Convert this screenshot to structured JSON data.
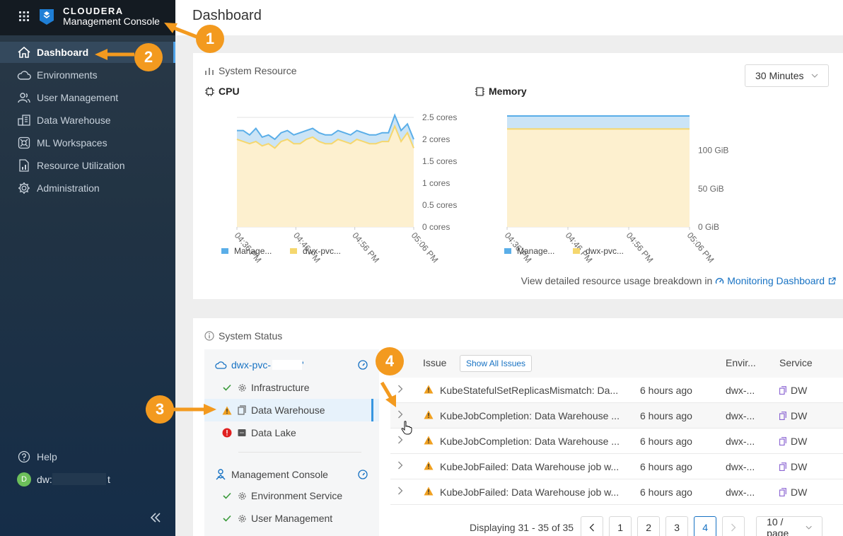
{
  "sidebar": {
    "brand_name": "CLOUDERA",
    "brand_sub": "Management Console",
    "items": [
      {
        "label": "Dashboard",
        "icon": "home-icon",
        "active": true
      },
      {
        "label": "Environments",
        "icon": "cloud-icon"
      },
      {
        "label": "User Management",
        "icon": "users-icon"
      },
      {
        "label": "Data Warehouse",
        "icon": "warehouse-icon"
      },
      {
        "label": "ML Workspaces",
        "icon": "ml-icon"
      },
      {
        "label": "Resource Utilization",
        "icon": "resource-icon"
      },
      {
        "label": "Administration",
        "icon": "gear-icon"
      }
    ],
    "help": "Help",
    "avatar_initial": "D",
    "user_prefix": "dw:",
    "user_suffix": "t"
  },
  "header": {
    "title": "Dashboard"
  },
  "resource": {
    "title": "System Resource",
    "range": "30 Minutes",
    "breakdown_text": "View detailed resource usage breakdown in",
    "breakdown_link": "Monitoring Dashboard"
  },
  "chart_data": [
    {
      "type": "area",
      "title": "CPU",
      "x": [
        "04:36 PM",
        "04:46 PM",
        "04:56 PM",
        "05:06 PM"
      ],
      "yticks": [
        "2.5 cores",
        "2 cores",
        "1.5 cores",
        "1 cores",
        "0.5 cores",
        "0 cores"
      ],
      "ylim": [
        0,
        2.5
      ],
      "series": [
        {
          "name": "Manage...",
          "color": "#5aaee8",
          "values": [
            2.2,
            2.2,
            2.1,
            2.25,
            2.05,
            2.1,
            2.0,
            2.15,
            2.2,
            2.1,
            2.15,
            2.2,
            2.25,
            2.15,
            2.1,
            2.1,
            2.2,
            2.15,
            2.1,
            2.2,
            2.15,
            2.1,
            2.1,
            2.15,
            2.15,
            2.55,
            2.2,
            2.35,
            2.0
          ]
        },
        {
          "name": "dwx-pvc...",
          "color": "#f5d76e",
          "values": [
            2.0,
            1.95,
            1.9,
            1.95,
            1.85,
            1.9,
            1.8,
            1.95,
            2.0,
            1.9,
            1.9,
            2.0,
            2.05,
            1.95,
            1.9,
            1.9,
            2.0,
            1.95,
            1.9,
            2.0,
            1.95,
            1.9,
            1.9,
            1.95,
            1.95,
            2.3,
            1.95,
            2.15,
            1.8
          ]
        }
      ]
    },
    {
      "type": "area",
      "title": "Memory",
      "x": [
        "04:36 PM",
        "04:46 PM",
        "04:56 PM",
        "05:06 PM"
      ],
      "yticks": [
        "100 GiB",
        "50 GiB",
        "0 GiB"
      ],
      "ylim": [
        0,
        145
      ],
      "series": [
        {
          "name": "Manage...",
          "color": "#5aaee8",
          "values": [
            145,
            145,
            145,
            145,
            145
          ]
        },
        {
          "name": "dwx-pvc...",
          "color": "#f5d76e",
          "values": [
            128,
            128,
            128,
            128,
            128
          ]
        }
      ]
    }
  ],
  "status": {
    "title": "System Status",
    "env_name": "dwx-pvc-",
    "env_tail": "'",
    "env_children": [
      {
        "label": "Infrastructure",
        "state": "ok"
      },
      {
        "label": "Data Warehouse",
        "state": "warning",
        "selected": true
      },
      {
        "label": "Data Lake",
        "state": "error"
      }
    ],
    "mc_name": "Management Console",
    "mc_children": [
      {
        "label": "Environment Service",
        "state": "ok"
      },
      {
        "label": "User Management",
        "state": "ok"
      }
    ]
  },
  "issues": {
    "headers": {
      "issue": "Issue",
      "env": "Envir...",
      "service": "Service"
    },
    "show_all": "Show All Issues",
    "rows": [
      {
        "issue": "KubeStatefulSetReplicasMismatch: Da...",
        "time": "6 hours ago",
        "env": "dwx-...",
        "service": "DW"
      },
      {
        "issue": "KubeJobCompletion: Data Warehouse ...",
        "time": "6 hours ago",
        "env": "dwx-...",
        "service": "DW"
      },
      {
        "issue": "KubeJobCompletion: Data Warehouse ...",
        "time": "6 hours ago",
        "env": "dwx-...",
        "service": "DW"
      },
      {
        "issue": "KubeJobFailed: Data Warehouse job w...",
        "time": "6 hours ago",
        "env": "dwx-...",
        "service": "DW"
      },
      {
        "issue": "KubeJobFailed: Data Warehouse job w...",
        "time": "6 hours ago",
        "env": "dwx-...",
        "service": "DW"
      }
    ],
    "pagination": {
      "label": "Displaying 31 - 35 of 35",
      "pages": [
        "1",
        "2",
        "3",
        "4"
      ],
      "current": "4",
      "page_size": "10 / page"
    }
  },
  "callouts": [
    "1",
    "2",
    "3",
    "4"
  ],
  "colors": {
    "accent": "#1772c3",
    "callout": "#f39a1f",
    "warning": "#f0a020",
    "error": "#e02020",
    "ok": "#3a9a3a"
  }
}
